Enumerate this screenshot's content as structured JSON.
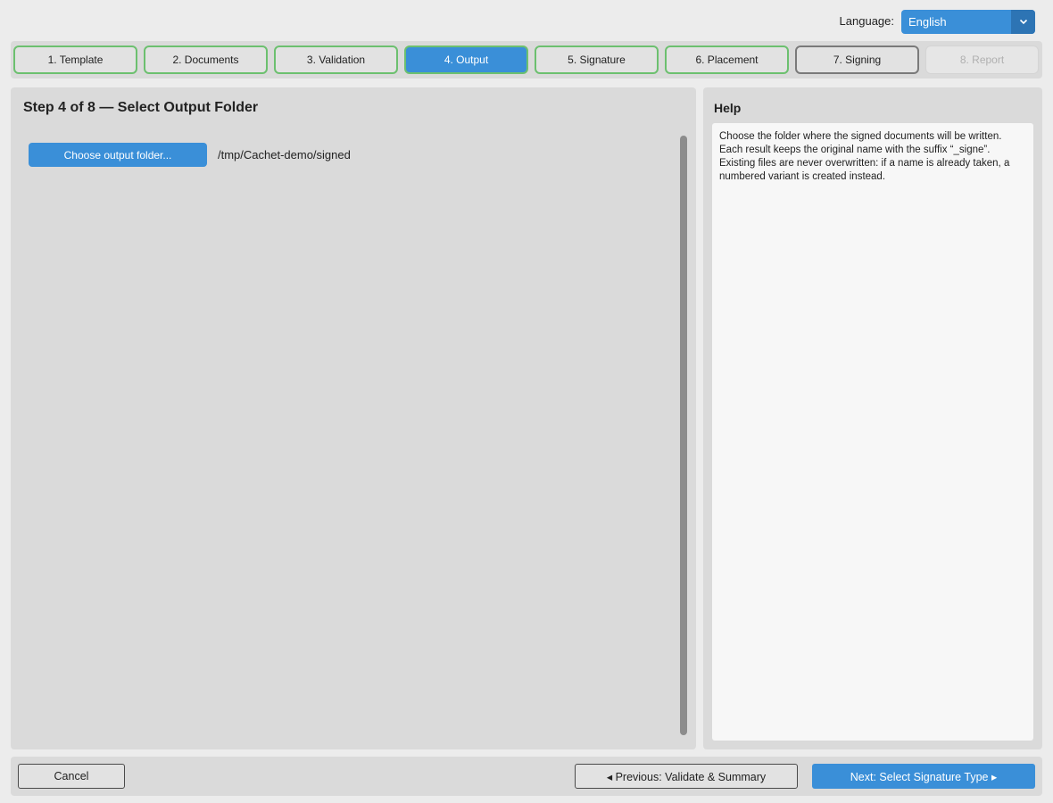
{
  "language": {
    "label": "Language:",
    "selected": "English"
  },
  "steps": [
    {
      "label": "1. Template",
      "state": "done"
    },
    {
      "label": "2. Documents",
      "state": "done"
    },
    {
      "label": "3. Validation",
      "state": "done"
    },
    {
      "label": "4. Output",
      "state": "active"
    },
    {
      "label": "5. Signature",
      "state": "done"
    },
    {
      "label": "6. Placement",
      "state": "done"
    },
    {
      "label": "7. Signing",
      "state": "pending"
    },
    {
      "label": "8. Report",
      "state": "disabled"
    }
  ],
  "main": {
    "title": "Step 4 of 8 — Select Output Folder",
    "choose_button": "Choose output folder...",
    "output_path": "/tmp/Cachet-demo/signed"
  },
  "help": {
    "title": "Help",
    "lines": [
      "Choose the folder where the signed documents will be written.",
      "Each result keeps the original name with the suffix “_signe”.",
      "Existing files are never overwritten: if a name is already taken, a",
      "numbered variant is created instead."
    ]
  },
  "footer": {
    "cancel": "Cancel",
    "previous": "◂  Previous: Validate & Summary",
    "next": "Next: Select Signature Type  ▸"
  },
  "colors": {
    "accent": "#3a8fd8",
    "done_border": "#6cc06f"
  }
}
